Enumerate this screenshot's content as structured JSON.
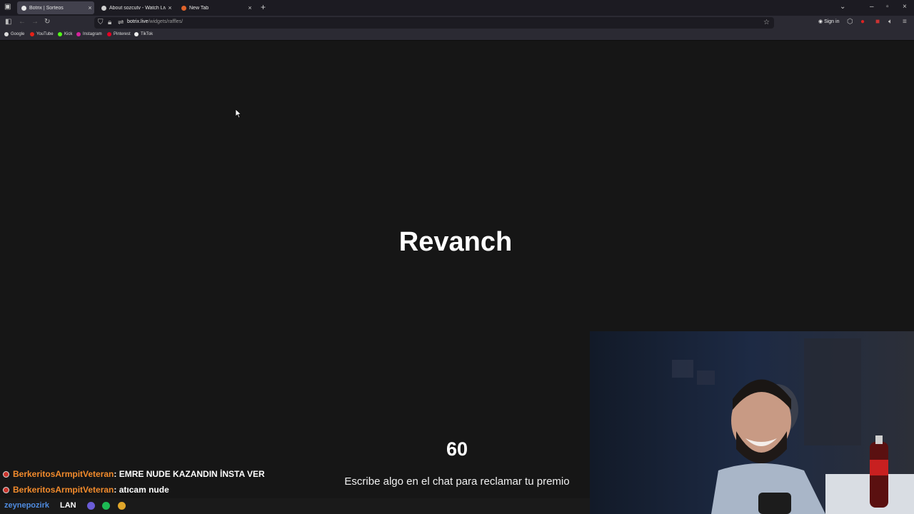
{
  "browser": {
    "tabs": [
      {
        "label": "Botrix | Sorteos",
        "active": true,
        "favicon_color": "#e8e8e8"
      },
      {
        "label": "About sozcutv - Watch Live on Kick",
        "active": false,
        "favicon_color": "#cfcfcf"
      },
      {
        "label": "New Tab",
        "active": false,
        "favicon_color": "#e0632a"
      }
    ],
    "url_host": "botrix.live",
    "url_path": "/widgets/raffles/",
    "signin_label": "Sign in",
    "bookmarks": [
      {
        "label": "Google",
        "color": "#dddddd"
      },
      {
        "label": "YouTube",
        "color": "#e62117"
      },
      {
        "label": "Kick",
        "color": "#53fc18"
      },
      {
        "label": "Instagram",
        "color": "#d6249f"
      },
      {
        "label": "Pinterest",
        "color": "#e60023"
      },
      {
        "label": "TikTok",
        "color": "#eeeeee"
      }
    ]
  },
  "raffle": {
    "keyword": "Revanch",
    "countdown": "60",
    "instruction": "Escribe algo en el chat para reclamar tu premio"
  },
  "chat": [
    {
      "user": "BerkeritosArmpitVeteran",
      "message": " : EMRE NUDE KAZANDIN İNSTA VER"
    },
    {
      "user": "BerkeritosArmpitVeteran",
      "message": " : atıcam nude"
    }
  ],
  "overlay": {
    "handle": "zeynepozirk",
    "lan_label": "LAN"
  },
  "colors": {
    "background": "#161616",
    "username": "#f28b2c",
    "handle": "#4f8ce0"
  }
}
